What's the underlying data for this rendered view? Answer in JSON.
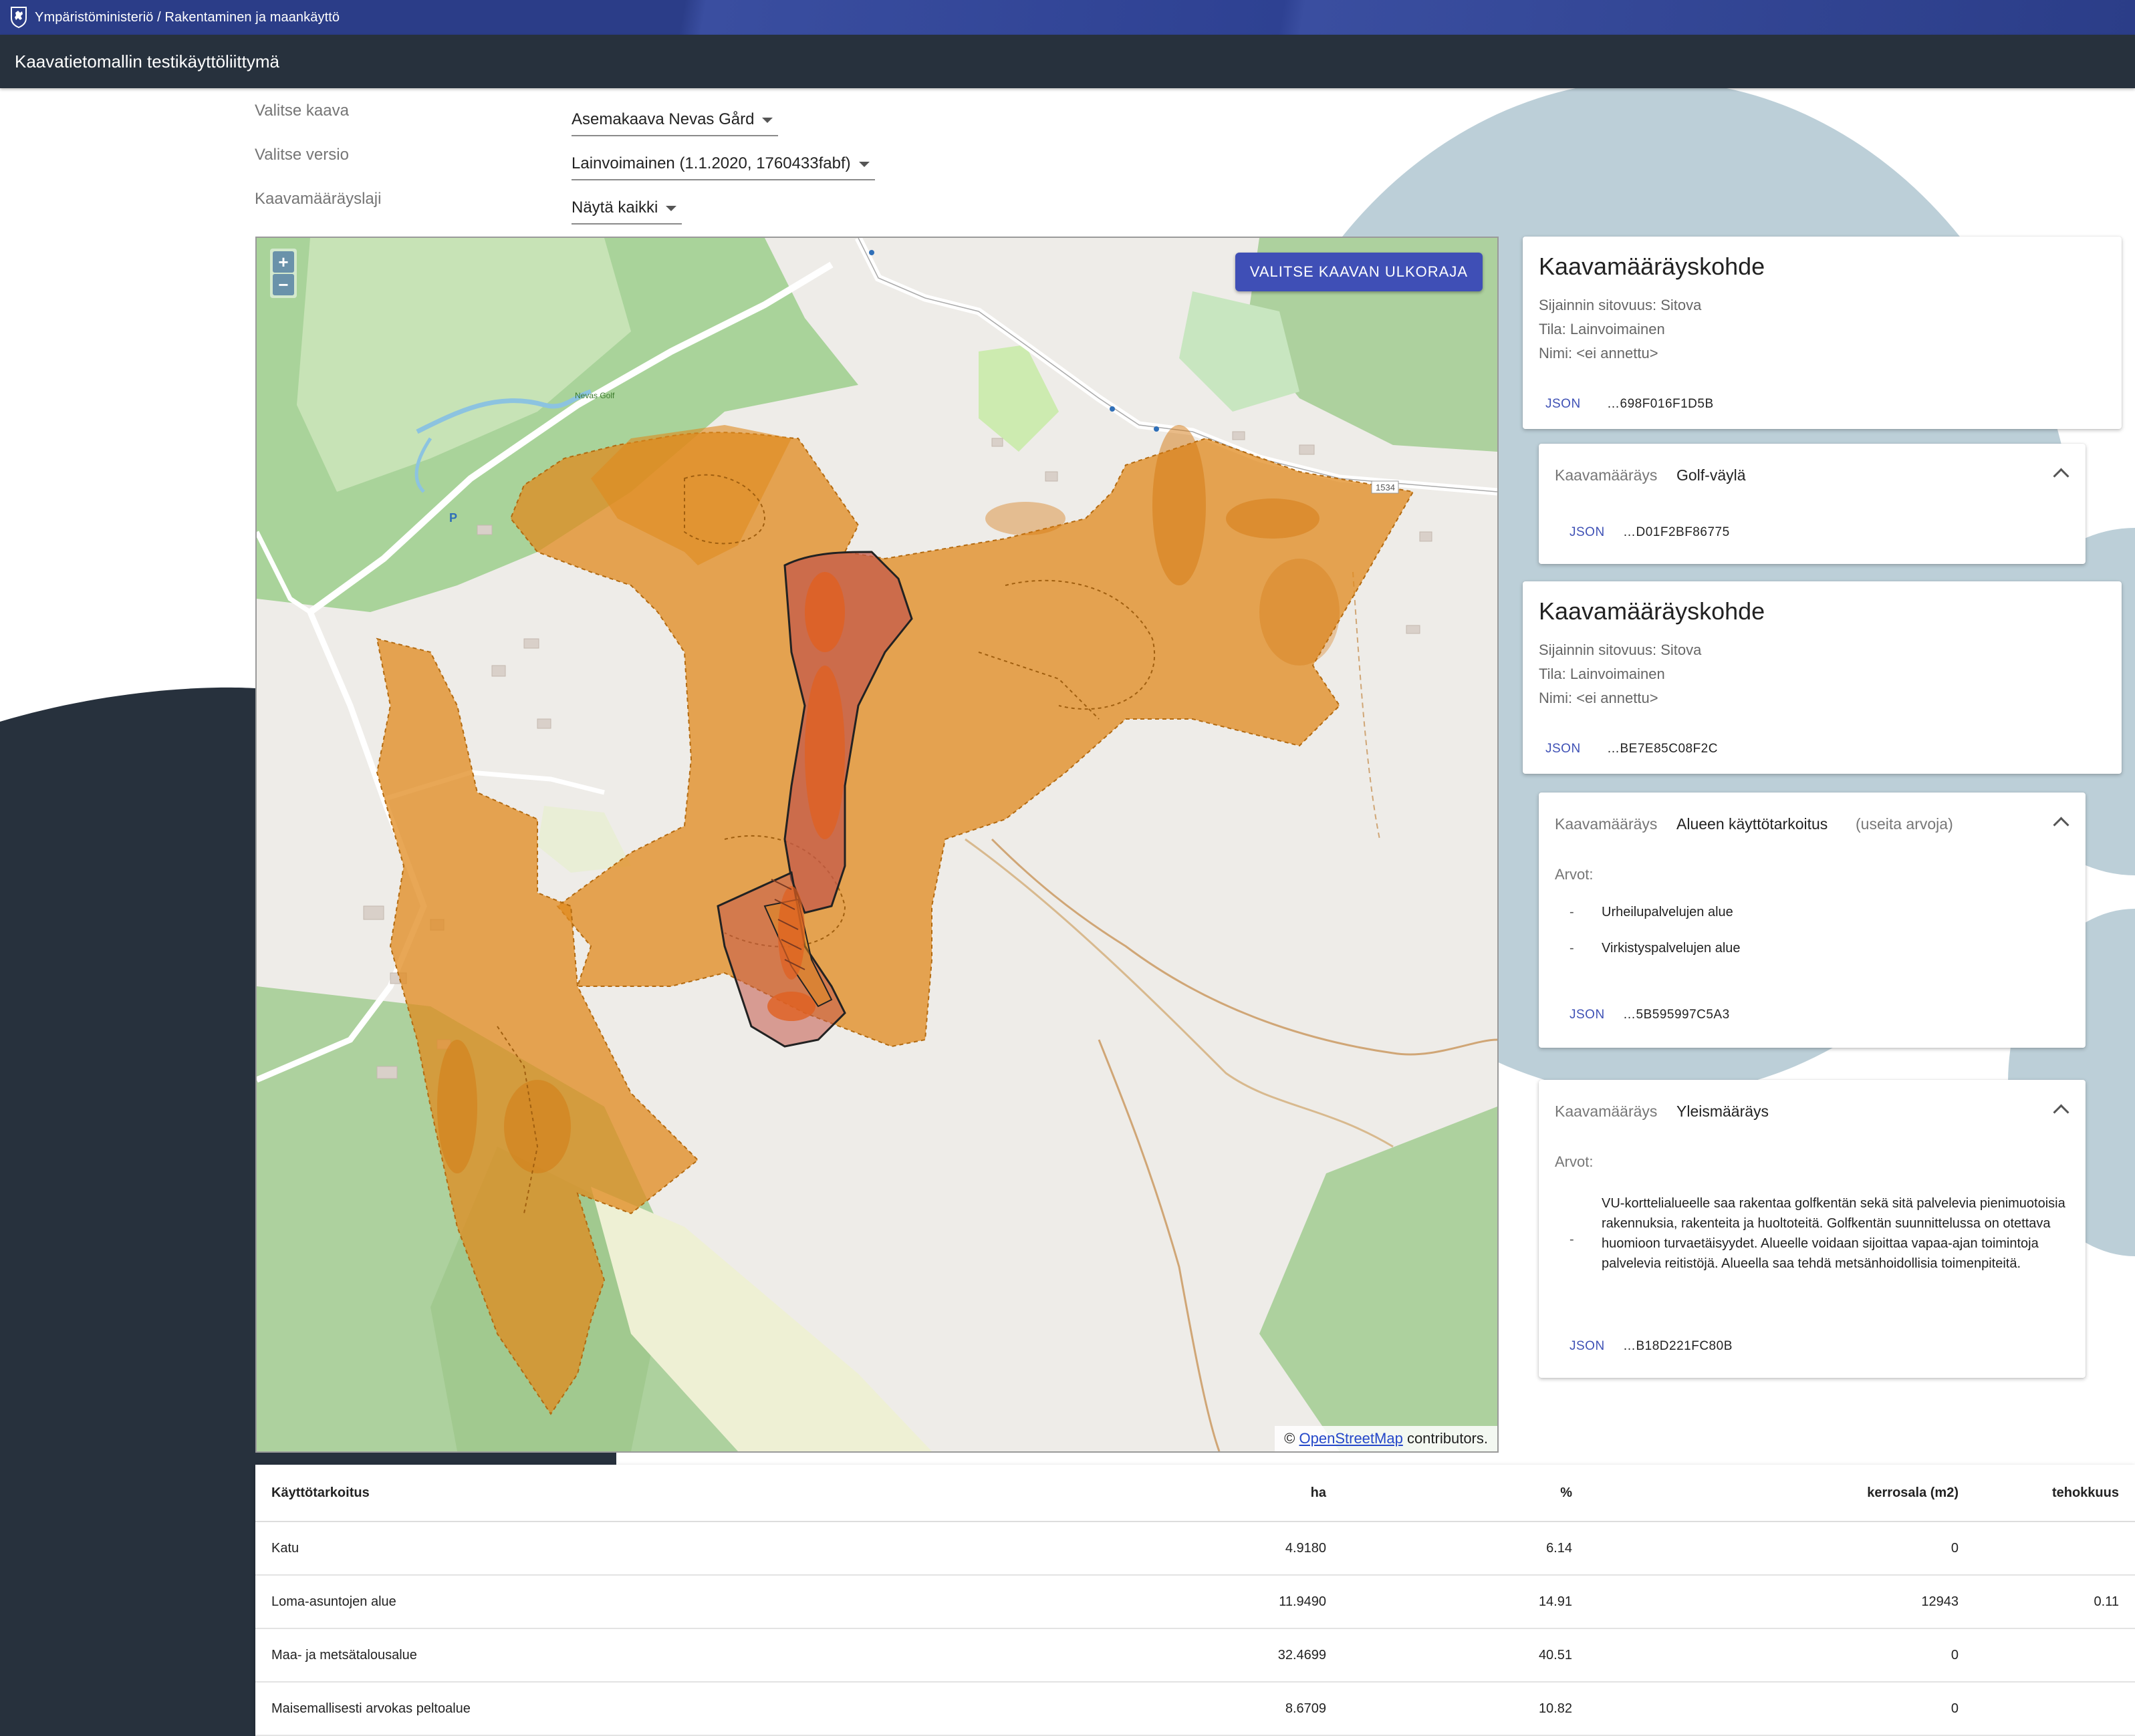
{
  "ministry": {
    "breadcrumb": "Ympäristöministeriö / Rakentaminen ja maankäyttö"
  },
  "app": {
    "title": "Kaavatietomallin testikäyttöliittymä"
  },
  "selectors": [
    {
      "label": "Valitse kaava",
      "value": "Asemakaava Nevas Gård"
    },
    {
      "label": "Valitse versio",
      "value": "Lainvoimainen (1.1.2020, 1760433fabf)"
    },
    {
      "label": "Kaavamääräyslaji",
      "value": "Näytä kaikki"
    }
  ],
  "map": {
    "zoom_in": "+",
    "zoom_out": "−",
    "outline_button": "VALITSE KAAVAN ULKORAJA",
    "attribution_prefix": "©",
    "attribution_link": "OpenStreetMap",
    "attribution_suffix": " contributors.",
    "labels": [
      "1534",
      "P",
      "Nevas Golf"
    ]
  },
  "cards": {
    "target1": {
      "title": "Kaavamääräyskohde",
      "binding": "Sijainnin sitovuus: Sitova",
      "status": "Tila: Lainvoimainen",
      "name": "Nimi: <ei annettu>",
      "json_label": "JSON",
      "id": "…698F016F1D5B"
    },
    "reg1": {
      "label": "Kaavamääräys",
      "value": "Golf-väylä",
      "json_label": "JSON",
      "id": "…D01F2BF86775"
    },
    "target2": {
      "title": "Kaavamääräyskohde",
      "binding": "Sijainnin sitovuus: Sitova",
      "status": "Tila: Lainvoimainen",
      "name": "Nimi: <ei annettu>",
      "json_label": "JSON",
      "id": "…BE7E85C08F2C"
    },
    "reg2": {
      "label": "Kaavamääräys",
      "value": "Alueen käyttötarkoitus",
      "extra": "(useita arvoja)",
      "values_label": "Arvot:",
      "values": [
        "Urheilupalvelujen alue",
        "Virkistyspalvelujen alue"
      ],
      "json_label": "JSON",
      "id": "…5B595997C5A3"
    },
    "reg3": {
      "label": "Kaavamääräys",
      "value": "Yleismääräys",
      "values_label": "Arvot:",
      "text": "VU-korttelialueelle saa rakentaa golfkentän sekä sitä palvelevia pienimuotoisia rakennuksia, rakenteita ja huoltoteitä. Golfkentän suunnittelussa on otettava huomioon turvaetäisyydet. Alueelle voidaan sijoittaa vapaa-ajan toimintoja palvelevia reitistöjä. Alueella saa tehdä metsänhoidollisia toimenpiteitä.",
      "json_label": "JSON",
      "id": "…B18D221FC80B"
    }
  },
  "table": {
    "headers": [
      "Käyttötarkoitus",
      "ha",
      "%",
      "kerrosala (m2)",
      "tehokkuus"
    ],
    "rows": [
      [
        "Katu",
        "4.9180",
        "6.14",
        "0",
        ""
      ],
      [
        "Loma-asuntojen alue",
        "11.9490",
        "14.91",
        "12943",
        "0.11"
      ],
      [
        "Maa- ja metsätalousalue",
        "32.4699",
        "40.51",
        "0",
        ""
      ],
      [
        "Maisemallisesti arvokas peltoalue",
        "8.6709",
        "10.82",
        "0",
        ""
      ]
    ]
  },
  "colors": {
    "ministry_bar": "#2b3d88",
    "app_bar": "#27313d",
    "accent": "#3f51b5",
    "plan_area": "#e08a1e",
    "golf_area": "#d0603a"
  }
}
